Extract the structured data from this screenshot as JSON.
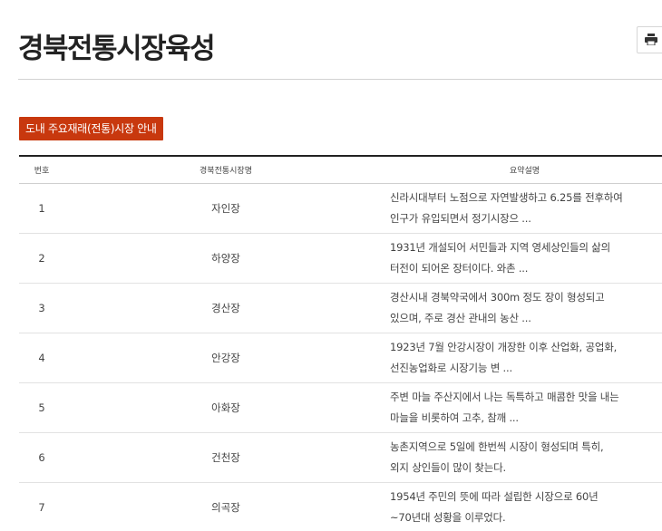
{
  "page": {
    "title": "경북전통시장육성"
  },
  "toolbar": {
    "print_icon": "printer-icon"
  },
  "guide_button": {
    "label": "도내 주요재래(전통)시장 안내"
  },
  "table": {
    "headers": {
      "no": "번호",
      "name": "경북전통시장명",
      "desc": "요약설명"
    },
    "rows": [
      {
        "no": "1",
        "name": "자인장",
        "desc": [
          "신라시대부터 노점으로 자연발생하고 6.25를 전후하여",
          "인구가 유입되면서 정기시장으 ..."
        ]
      },
      {
        "no": "2",
        "name": "하양장",
        "desc": [
          "1931년 개설되어 서민들과 지역 영세상인들의 삶의",
          "터전이 되어온 장터이다. 와촌 ..."
        ]
      },
      {
        "no": "3",
        "name": "경산장",
        "desc": [
          "경산시내 경북약국에서 300m 정도 장이 형성되고",
          "있으며, 주로 경산 관내의 농산 ..."
        ]
      },
      {
        "no": "4",
        "name": "안강장",
        "desc": [
          "1923년 7월 안강시장이 개장한 이후 산업화, 공업화,",
          "선진농업화로 시장기능 변 ..."
        ]
      },
      {
        "no": "5",
        "name": "아화장",
        "desc": [
          "주변 마늘 주산지에서 나는 독특하고 매콤한 맛을 내는",
          "마늘을 비롯하여 고추, 참깨 ..."
        ]
      },
      {
        "no": "6",
        "name": "건천장",
        "desc": [
          "농촌지역으로 5일에 한번씩 시장이 형성되며 특히,",
          "외지 상인들이 많이 찾는다."
        ]
      },
      {
        "no": "7",
        "name": "의곡장",
        "desc": [
          "1954년 주민의 뜻에 따라 설립한 시장으로 60년",
          "~70년대 성황을 이루었다."
        ]
      }
    ]
  }
}
